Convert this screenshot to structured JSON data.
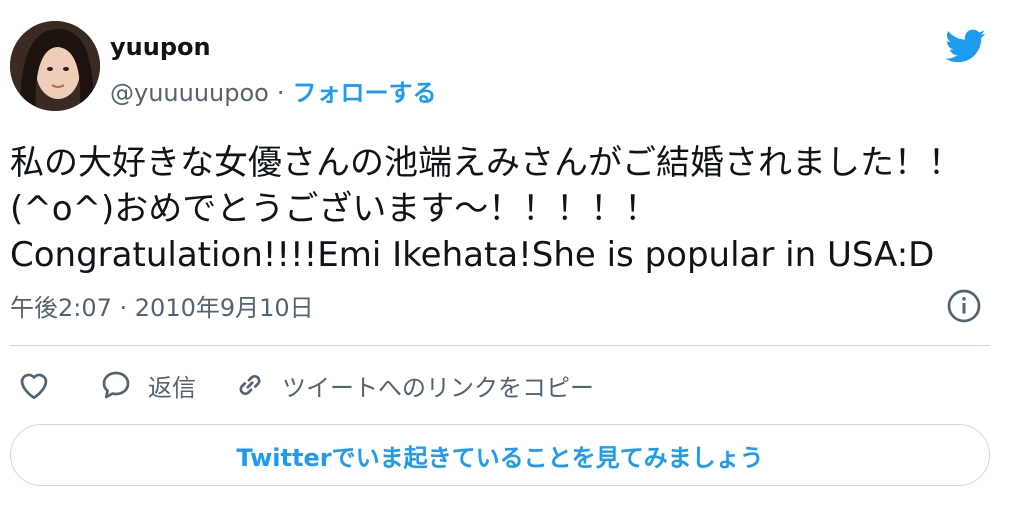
{
  "author": {
    "display_name": "yuupon",
    "handle": "@yuuuuupoo",
    "separator": "·",
    "follow_label": "フォローする"
  },
  "tweet": {
    "text": "私の大好きな女優さんの池端えみさんがご結婚されました！！(^o^)おめでとうございます〜！！！！！\nCongratulation!!!!Emi Ikehata!She is popular in USA:D",
    "timestamp": "午後2:07 · 2010年9月10日"
  },
  "actions": {
    "like_icon": "heart-icon",
    "reply_label": "返信",
    "reply_icon": "speech-bubble-icon",
    "copy_link_label": "ツイートへのリンクをコピー",
    "copy_link_icon": "link-icon"
  },
  "cta": {
    "label": "Twitterでいま起きていることを見てみましょう"
  },
  "icons": {
    "brand": "twitter-bird-icon",
    "info": "info-icon"
  },
  "colors": {
    "accent": "#1d9bf0",
    "text": "#0f1419",
    "secondary": "#536471",
    "border": "#cfd9de"
  }
}
